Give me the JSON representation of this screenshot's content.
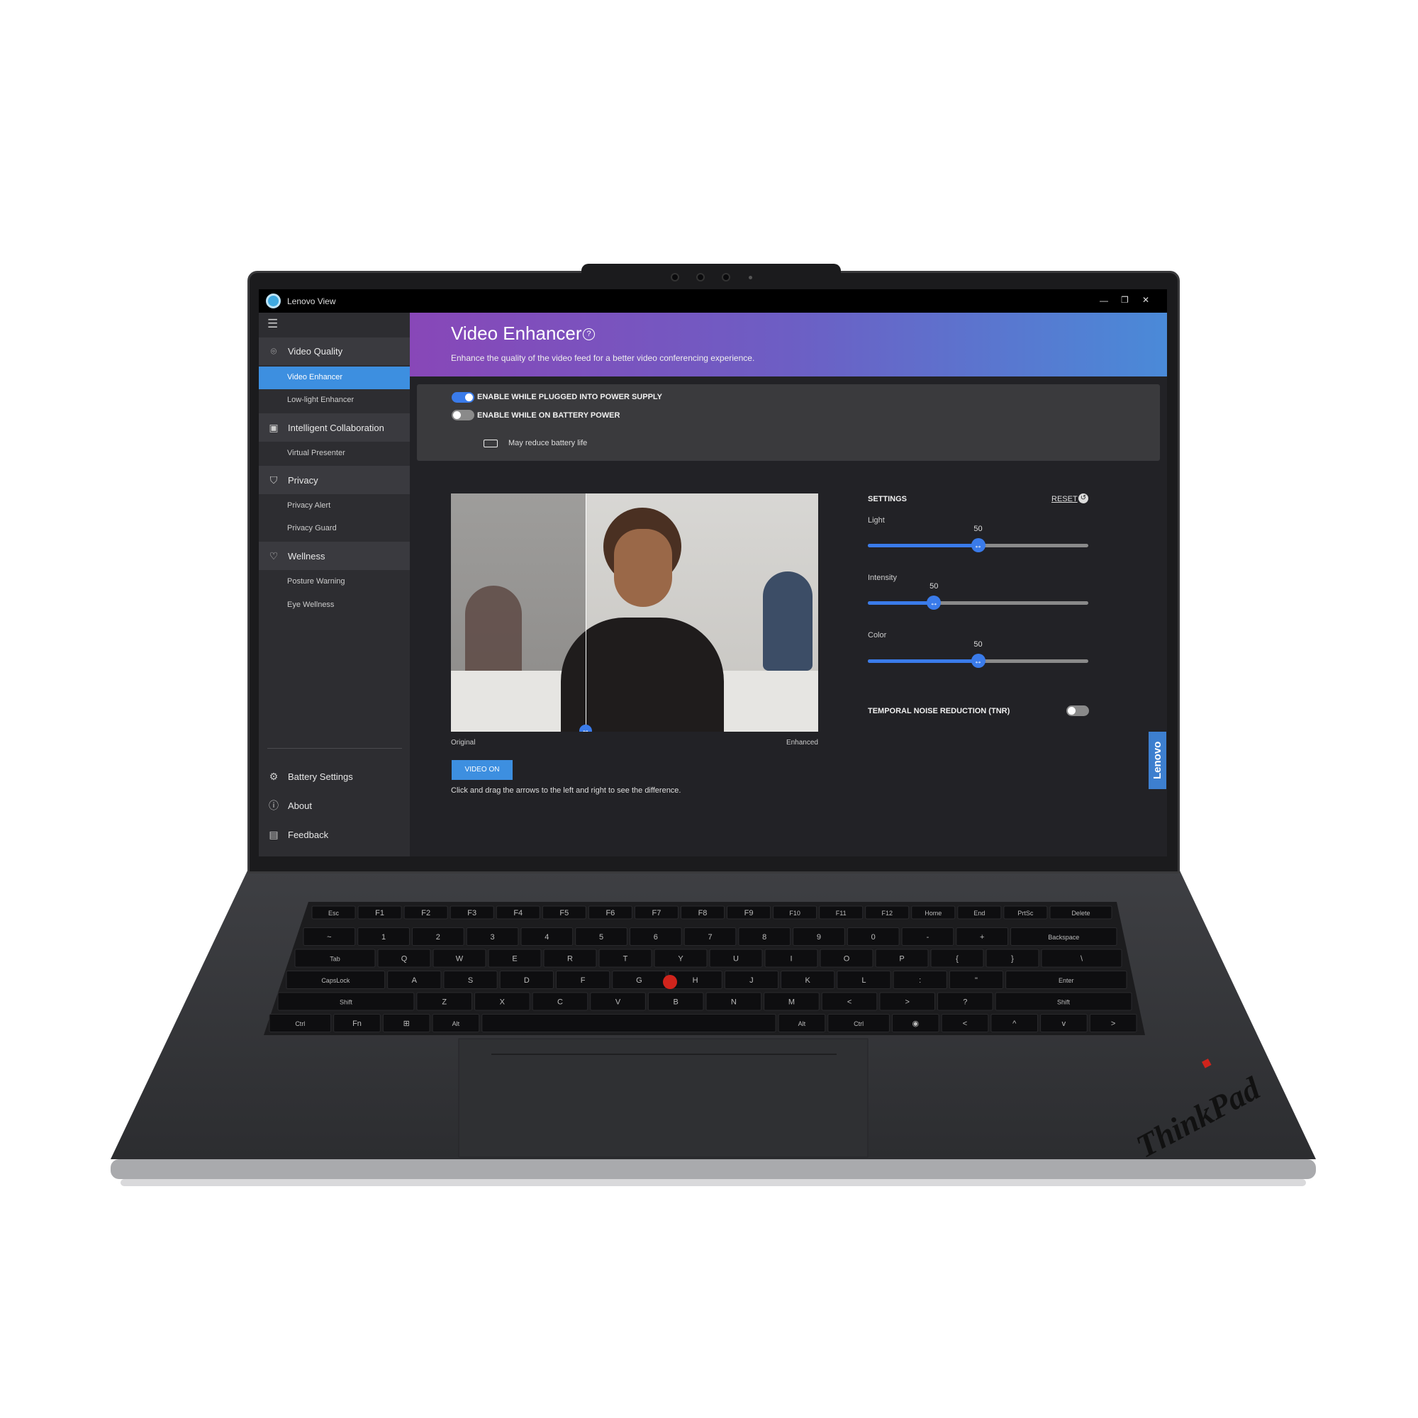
{
  "app": {
    "title": "Lenovo View",
    "controls": {
      "minimize": "—",
      "restore": "❐",
      "close": "✕"
    }
  },
  "sidebar": {
    "menu_icon": "☰",
    "groups": [
      {
        "label": "Video Quality",
        "icon": "camera-person-icon",
        "items": [
          "Video Enhancer",
          "Low-light Enhancer"
        ]
      },
      {
        "label": "Intelligent Collaboration",
        "icon": "monitor-shield-icon",
        "items": [
          "Virtual Presenter"
        ]
      },
      {
        "label": "Privacy",
        "icon": "shield-icon",
        "items": [
          "Privacy Alert",
          "Privacy Guard"
        ]
      },
      {
        "label": "Wellness",
        "icon": "heart-icon",
        "items": [
          "Posture Warning",
          "Eye Wellness"
        ]
      }
    ],
    "selected": "Video Enhancer",
    "footer": [
      {
        "label": "Battery Settings",
        "icon": "gear-icon"
      },
      {
        "label": "About",
        "icon": "info-icon"
      },
      {
        "label": "Feedback",
        "icon": "feedback-icon"
      }
    ]
  },
  "header": {
    "title": "Video Enhancer",
    "subtitle": "Enhance the quality of the video feed for a better video conferencing experience.",
    "help_icon": "?"
  },
  "power": {
    "plugged": {
      "label": "ENABLE WHILE PLUGGED INTO POWER SUPPLY",
      "on": true
    },
    "battery": {
      "label": "ENABLE WHILE ON BATTERY POWER",
      "on": false,
      "note": "May reduce battery life"
    }
  },
  "preview": {
    "left_label": "Original",
    "right_label": "Enhanced",
    "video_button": "VIDEO ON",
    "hint": "Click and drag the arrows to the left and right to see the difference."
  },
  "settings": {
    "title": "SETTINGS",
    "reset": "RESET",
    "sliders": [
      {
        "label": "Light",
        "value": "50",
        "fill": 0.5
      },
      {
        "label": "Intensity",
        "value": "50",
        "fill": 0.3
      },
      {
        "label": "Color",
        "value": "50",
        "fill": 0.5
      }
    ],
    "tnr": {
      "label": "TEMPORAL NOISE REDUCTION (TNR)",
      "on": false
    }
  },
  "brand_tab": "Lenovo",
  "laptop_logo": "ThinkPad",
  "keyboard": {
    "rows": [
      [
        "Esc",
        "F1",
        "F2",
        "F3",
        "F4",
        "F5",
        "F6",
        "F7",
        "F8",
        "F9",
        "F10",
        "F11",
        "F12",
        "Home",
        "End",
        "PrtSc",
        "Delete"
      ],
      [
        "~",
        "1",
        "2",
        "3",
        "4",
        "5",
        "6",
        "7",
        "8",
        "9",
        "0",
        "-",
        "+",
        "Backspace"
      ],
      [
        "Tab",
        "Q",
        "W",
        "E",
        "R",
        "T",
        "Y",
        "U",
        "I",
        "O",
        "P",
        "{",
        "}",
        "\\"
      ],
      [
        "CapsLock",
        "A",
        "S",
        "D",
        "F",
        "G",
        "H",
        "J",
        "K",
        "L",
        ":",
        "\"",
        "Enter"
      ],
      [
        "Shift",
        "Z",
        "X",
        "C",
        "V",
        "B",
        "N",
        "M",
        "<",
        ">",
        "?",
        "Shift"
      ],
      [
        "Ctrl",
        "Fn",
        "⊞",
        "Alt",
        "",
        "Alt",
        "Ctrl",
        "◉",
        "<",
        "^",
        "v",
        ">"
      ]
    ]
  },
  "colors": {
    "accent": "#3a7bea",
    "selected": "#3d8fe0",
    "banner_start": "#8847b8",
    "banner_end": "#4a8ad8"
  }
}
